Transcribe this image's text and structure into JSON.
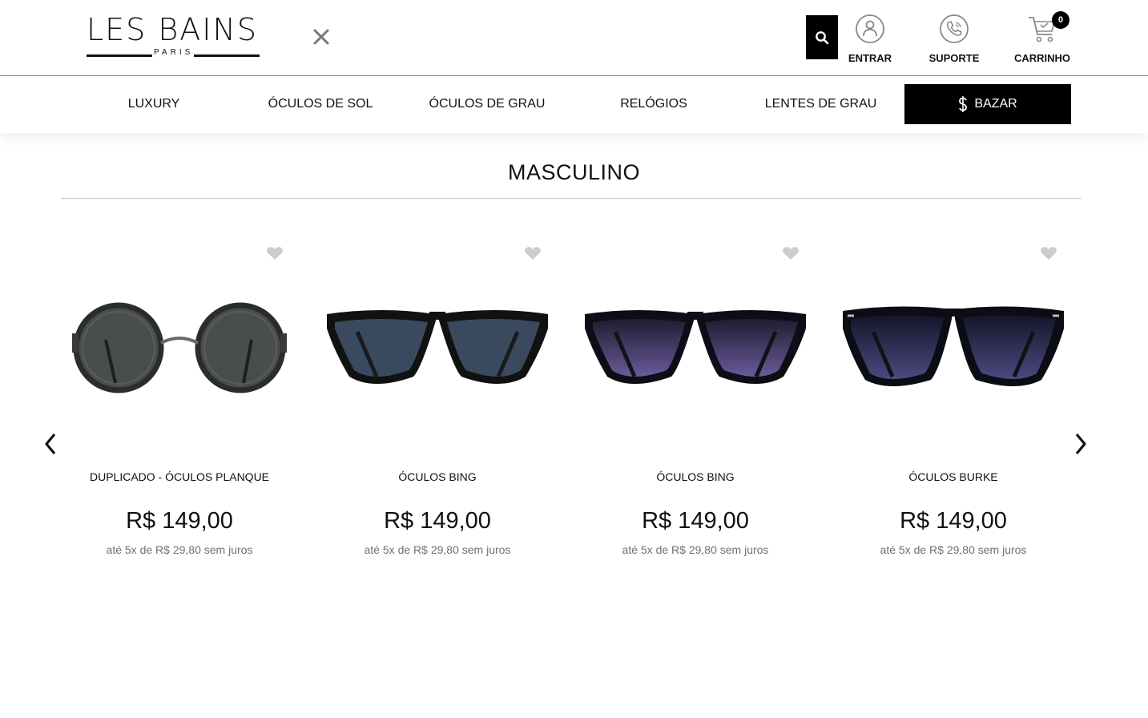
{
  "brand": {
    "name": "LES BAINS",
    "sub": "PARIS"
  },
  "header": {
    "actions": [
      {
        "label": "ENTRAR",
        "icon": "user-icon"
      },
      {
        "label": "SUPORTE",
        "icon": "phone-icon"
      },
      {
        "label": "CARRINHO",
        "icon": "cart-icon",
        "badge": "0"
      }
    ]
  },
  "nav": {
    "items": [
      "LUXURY",
      "ÓCULOS DE SOL",
      "ÓCULOS DE GRAU",
      "RELÓGIOS",
      "LENTES DE GRAU",
      "BAZAR"
    ]
  },
  "section": {
    "title": "MASCULINO"
  },
  "products": [
    {
      "name": "DUPLICADO - ÓCULOS PLANQUE",
      "price": "R$ 149,00",
      "installments": "até 5x de R$ 29,80 sem juros",
      "lens_color": "#4a4e4a"
    },
    {
      "name": "ÓCULOS BING",
      "price": "R$ 149,00",
      "installments": "até 5x de R$ 29,80 sem juros",
      "lens_color": "#3a4a5e"
    },
    {
      "name": "ÓCULOS BING",
      "price": "R$ 149,00",
      "installments": "até 5x de R$ 29,80 sem juros",
      "lens_color": "#4a3f6e"
    },
    {
      "name": "ÓCULOS BURKE",
      "price": "R$ 149,00",
      "installments": "até 5x de R$ 29,80 sem juros",
      "lens_color": "#2e2e52"
    }
  ],
  "colors": {
    "accent": "#000000",
    "muted_text": "#707070",
    "heart": "#cccccc"
  }
}
